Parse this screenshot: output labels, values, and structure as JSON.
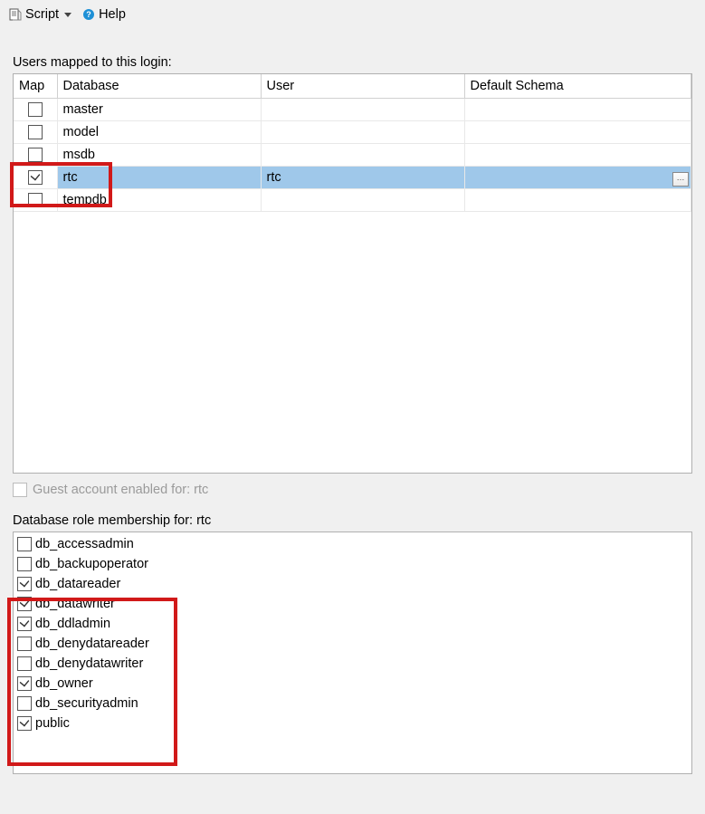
{
  "toolbar": {
    "script_label": "Script",
    "help_label": "Help"
  },
  "users_mapped_label": "Users mapped to this login:",
  "columns": {
    "map": "Map",
    "database": "Database",
    "user": "User",
    "default_schema": "Default Schema"
  },
  "rows": [
    {
      "map": false,
      "database": "master",
      "user": "",
      "schema": "",
      "selected": false
    },
    {
      "map": false,
      "database": "model",
      "user": "",
      "schema": "",
      "selected": false
    },
    {
      "map": false,
      "database": "msdb",
      "user": "",
      "schema": "",
      "selected": false
    },
    {
      "map": true,
      "database": "rtc",
      "user": "rtc",
      "schema": "",
      "selected": true
    },
    {
      "map": false,
      "database": "tempdb",
      "user": "",
      "schema": "",
      "selected": false
    }
  ],
  "guest_label": "Guest account enabled for: rtc",
  "guest_checked": false,
  "roles_label": "Database role membership for: rtc",
  "roles": [
    {
      "name": "db_accessadmin",
      "checked": false
    },
    {
      "name": "db_backupoperator",
      "checked": false
    },
    {
      "name": "db_datareader",
      "checked": true
    },
    {
      "name": "db_datawriter",
      "checked": true
    },
    {
      "name": "db_ddladmin",
      "checked": true
    },
    {
      "name": "db_denydatareader",
      "checked": false
    },
    {
      "name": "db_denydatawriter",
      "checked": false
    },
    {
      "name": "db_owner",
      "checked": true
    },
    {
      "name": "db_securityadmin",
      "checked": false
    },
    {
      "name": "public",
      "checked": true
    }
  ]
}
